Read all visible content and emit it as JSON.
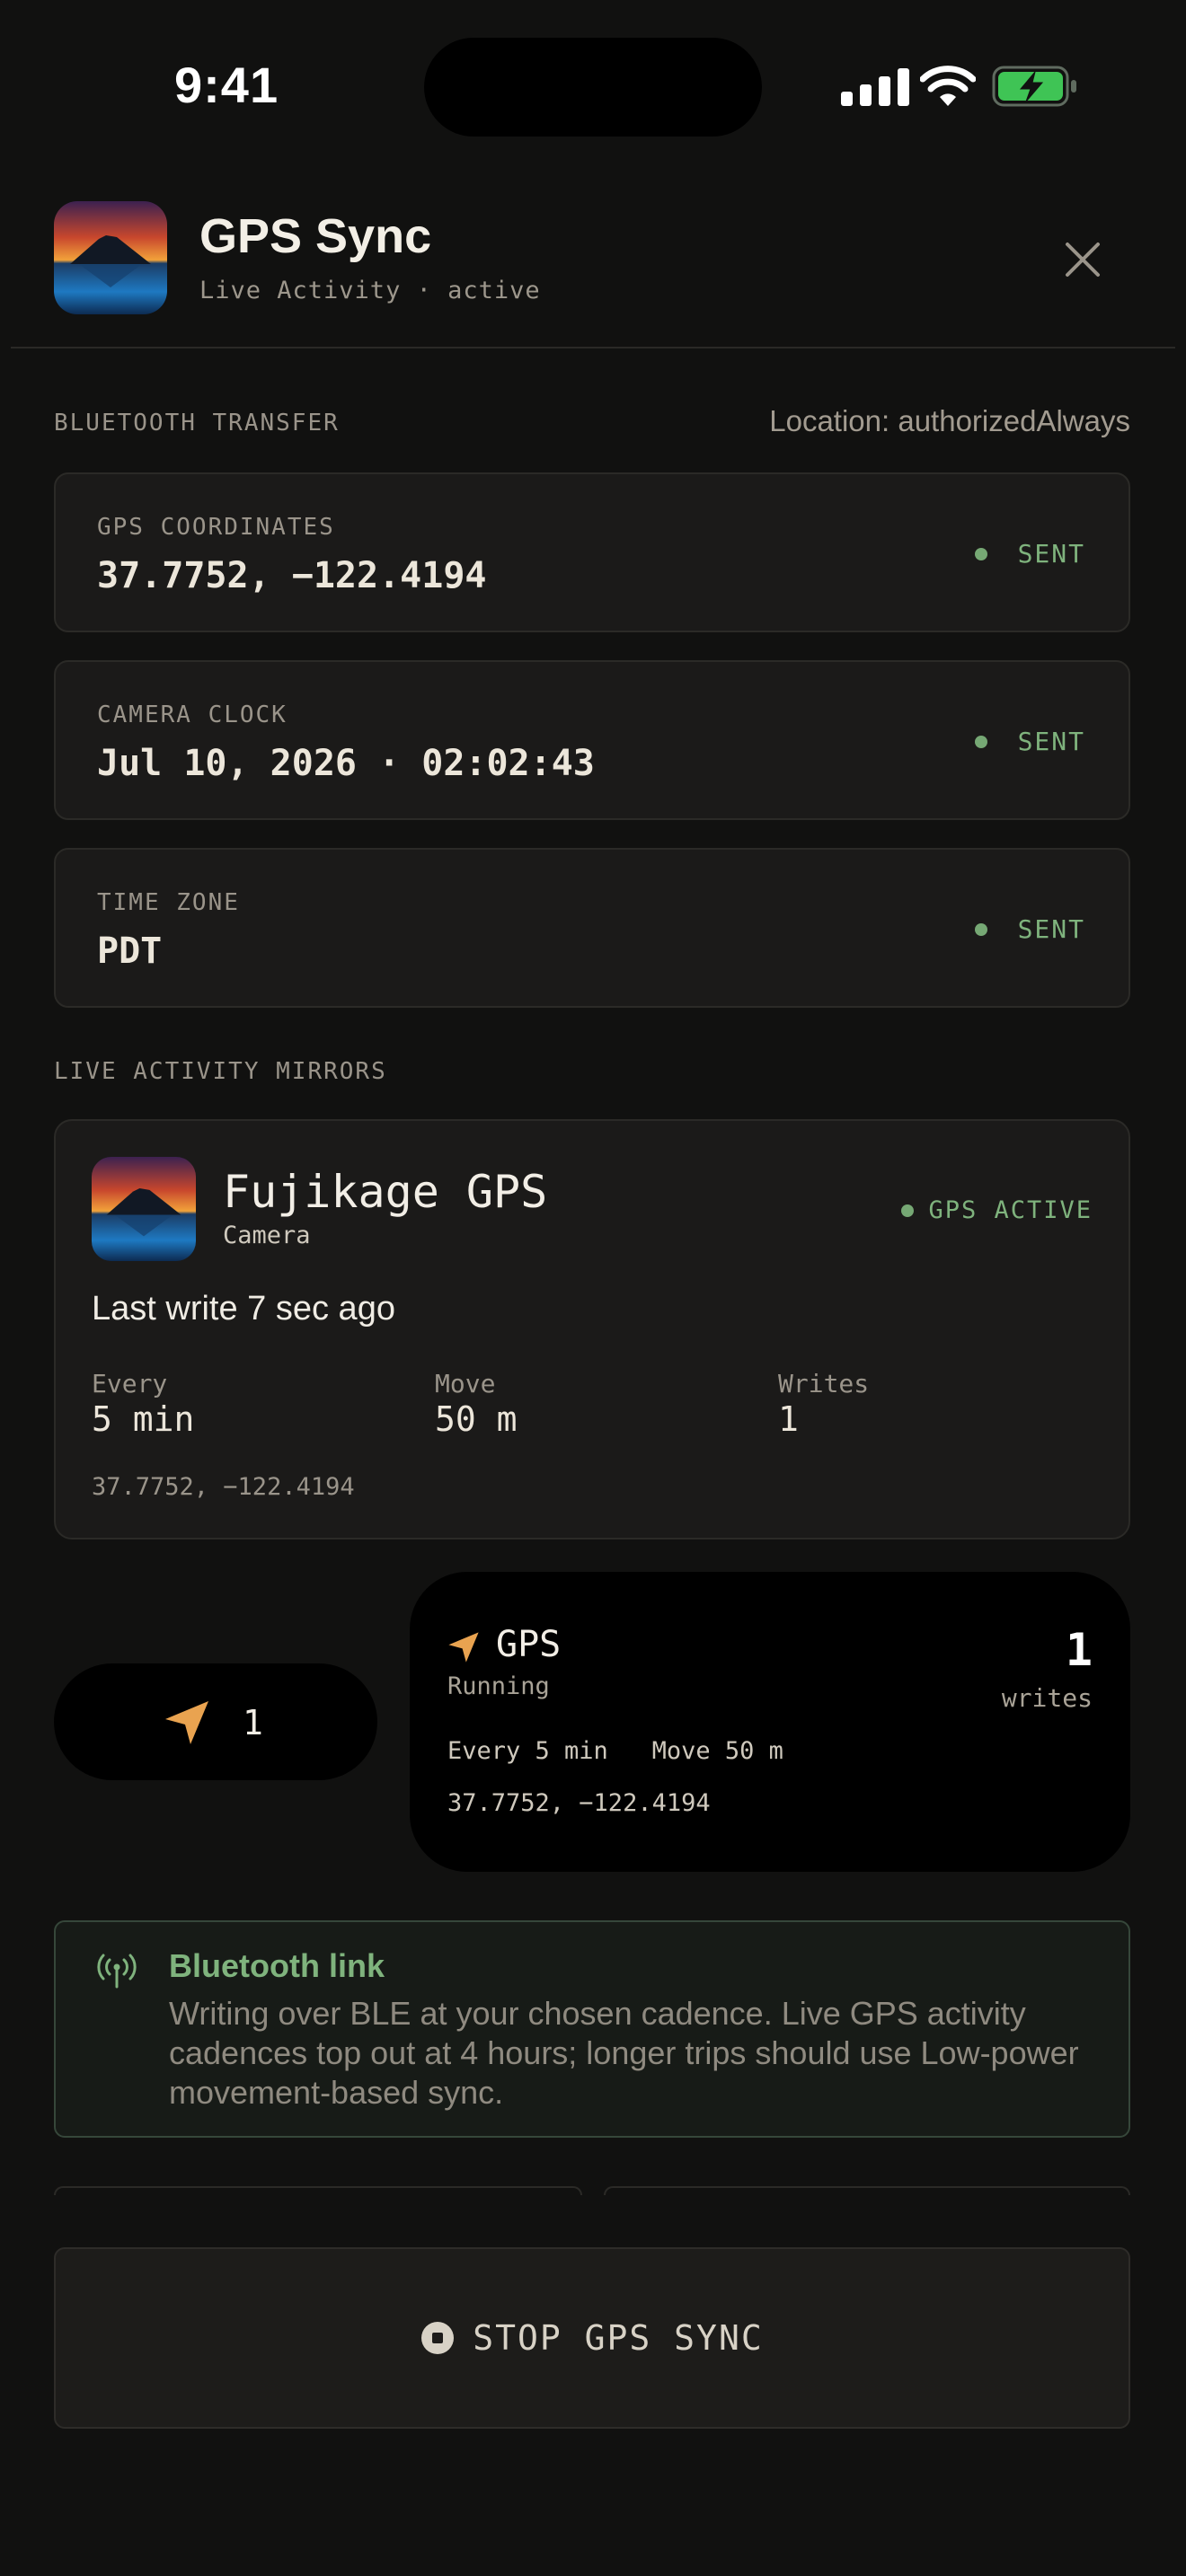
{
  "status_bar": {
    "time": "9:41",
    "icons": [
      "signal-icon",
      "wifi-icon",
      "battery-charging-icon"
    ]
  },
  "header": {
    "title": "GPS Sync",
    "subtitle": "Live Activity · active",
    "close_icon": "close-icon"
  },
  "bluetooth": {
    "section_label": "BLUETOOTH TRANSFER",
    "location_status": "Location: authorizedAlways",
    "rows": [
      {
        "label": "GPS COORDINATES",
        "value": "37.7752, −122.4194",
        "status": "SENT"
      },
      {
        "label": "CAMERA CLOCK",
        "value": "Jul 10, 2026 · 02:02:43",
        "status": "SENT"
      },
      {
        "label": "TIME ZONE",
        "value": "PDT",
        "status": "SENT"
      }
    ]
  },
  "mirrors": {
    "section_label": "LIVE ACTIVITY MIRRORS",
    "card": {
      "title": "Fujikage GPS",
      "subtitle": "Camera",
      "badge": "GPS ACTIVE",
      "last_write": "Last write 7 sec ago",
      "stats": [
        {
          "label": "Every",
          "value": "5 min"
        },
        {
          "label": "Move",
          "value": "50 m"
        },
        {
          "label": "Writes",
          "value": "1"
        }
      ],
      "coords": "37.7752, −122.4194"
    },
    "compact": {
      "count": "1"
    },
    "expanded": {
      "title": "GPS",
      "state": "Running",
      "count": "1",
      "count_label": "writes",
      "detail": "Every 5 min   Move 50 m",
      "coords": "37.7752, −122.4194"
    }
  },
  "info": {
    "title": "Bluetooth link",
    "body": "Writing over BLE at your chosen cadence. Live GPS activity cadences top out at 4 hours; longer trips should use Low-power movement-based sync."
  },
  "stop_button": {
    "label": "STOP GPS SYNC"
  },
  "colors": {
    "background": "#111110",
    "card": "#1b1a19",
    "accent_green": "#7fb37d",
    "accent_orange": "#e9a350"
  }
}
